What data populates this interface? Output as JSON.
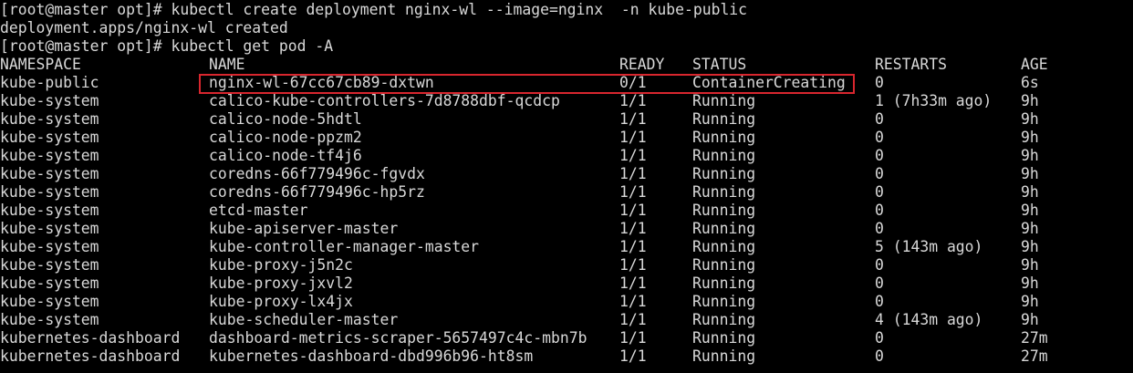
{
  "terminal": {
    "lines": [
      "[root@master opt]# kubectl create deployment nginx-wl --image=nginx  -n kube-public",
      "deployment.apps/nginx-wl created",
      "[root@master opt]# kubectl get pod -A"
    ],
    "colors": {
      "background": "#000000",
      "text": "#d8d8d8",
      "highlight": "#d8262e"
    },
    "table": {
      "headers": {
        "namespace": "NAMESPACE",
        "name": "NAME",
        "ready": "READY",
        "status": "STATUS",
        "restarts": "RESTARTS",
        "age": "AGE"
      },
      "rows": [
        {
          "namespace": "kube-public",
          "name": "nginx-wl-67cc67cb89-dxtwn",
          "ready": "0/1",
          "status": "ContainerCreating",
          "restarts": "0",
          "age": "6s"
        },
        {
          "namespace": "kube-system",
          "name": "calico-kube-controllers-7d8788dbf-qcdcp",
          "ready": "1/1",
          "status": "Running",
          "restarts": "1 (7h33m ago)",
          "age": "9h"
        },
        {
          "namespace": "kube-system",
          "name": "calico-node-5hdtl",
          "ready": "1/1",
          "status": "Running",
          "restarts": "0",
          "age": "9h"
        },
        {
          "namespace": "kube-system",
          "name": "calico-node-ppzm2",
          "ready": "1/1",
          "status": "Running",
          "restarts": "0",
          "age": "9h"
        },
        {
          "namespace": "kube-system",
          "name": "calico-node-tf4j6",
          "ready": "1/1",
          "status": "Running",
          "restarts": "0",
          "age": "9h"
        },
        {
          "namespace": "kube-system",
          "name": "coredns-66f779496c-fgvdx",
          "ready": "1/1",
          "status": "Running",
          "restarts": "0",
          "age": "9h"
        },
        {
          "namespace": "kube-system",
          "name": "coredns-66f779496c-hp5rz",
          "ready": "1/1",
          "status": "Running",
          "restarts": "0",
          "age": "9h"
        },
        {
          "namespace": "kube-system",
          "name": "etcd-master",
          "ready": "1/1",
          "status": "Running",
          "restarts": "0",
          "age": "9h"
        },
        {
          "namespace": "kube-system",
          "name": "kube-apiserver-master",
          "ready": "1/1",
          "status": "Running",
          "restarts": "0",
          "age": "9h"
        },
        {
          "namespace": "kube-system",
          "name": "kube-controller-manager-master",
          "ready": "1/1",
          "status": "Running",
          "restarts": "5 (143m ago)",
          "age": "9h"
        },
        {
          "namespace": "kube-system",
          "name": "kube-proxy-j5n2c",
          "ready": "1/1",
          "status": "Running",
          "restarts": "0",
          "age": "9h"
        },
        {
          "namespace": "kube-system",
          "name": "kube-proxy-jxvl2",
          "ready": "1/1",
          "status": "Running",
          "restarts": "0",
          "age": "9h"
        },
        {
          "namespace": "kube-system",
          "name": "kube-proxy-lx4jx",
          "ready": "1/1",
          "status": "Running",
          "restarts": "0",
          "age": "9h"
        },
        {
          "namespace": "kube-system",
          "name": "kube-scheduler-master",
          "ready": "1/1",
          "status": "Running",
          "restarts": "4 (143m ago)",
          "age": "9h"
        },
        {
          "namespace": "kubernetes-dashboard",
          "name": "dashboard-metrics-scraper-5657497c4c-mbn7b",
          "ready": "1/1",
          "status": "Running",
          "restarts": "0",
          "age": "27m"
        },
        {
          "namespace": "kubernetes-dashboard",
          "name": "kubernetes-dashboard-dbd996b96-ht8sm",
          "ready": "1/1",
          "status": "Running",
          "restarts": "0",
          "age": "27m"
        }
      ]
    }
  }
}
